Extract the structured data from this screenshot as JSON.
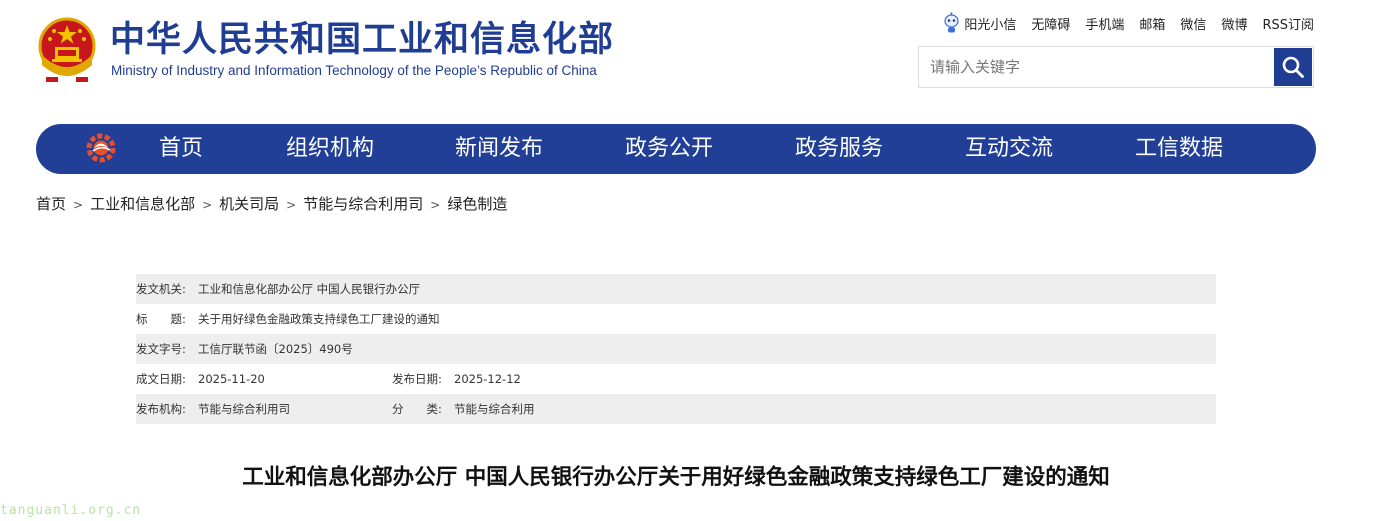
{
  "header": {
    "site_name_cn": "中华人民共和国工业和信息化部",
    "site_name_en": "Ministry of Industry and Information Technology of the People’s Republic of China",
    "emblem_icon": "national-emblem-icon",
    "brand_color": "#1f3d93"
  },
  "toplinks": {
    "robot_icon": "robot-assistant-icon",
    "items": [
      "阳光小信",
      "无障碍",
      "手机端",
      "邮箱",
      "微信",
      "微博",
      "RSS订阅"
    ]
  },
  "search": {
    "placeholder": "请输入关键字",
    "value": "",
    "button_icon": "search-icon"
  },
  "nav": {
    "logo_icon": "gear-logo-icon",
    "items": [
      "首页",
      "组织机构",
      "新闻发布",
      "政务公开",
      "政务服务",
      "互动交流",
      "工信数据"
    ]
  },
  "breadcrumb": {
    "separator": ">",
    "items": [
      "首页",
      "工业和信息化部",
      "机关司局",
      "节能与综合利用司",
      "绿色制造"
    ]
  },
  "meta": {
    "issuer_label": "发文机关:",
    "issuer": "工业和信息化部办公厅 中国人民银行办公厅",
    "subject_label": "标　　题:",
    "subject": "关于用好绿色金融政策支持绿色工厂建设的通知",
    "doc_no_label": "发文字号:",
    "doc_no": "工信厅联节函〔2025〕490号",
    "created_label": "成文日期:",
    "created": "2025-11-20",
    "published_label": "发布日期:",
    "published": "2025-12-12",
    "agency_label": "发布机构:",
    "agency": "节能与综合利用司",
    "category_label": "分　　类:",
    "category": "节能与综合利用"
  },
  "document": {
    "title": "工业和信息化部办公厅 中国人民银行办公厅关于用好绿色金融政策支持绿色工厂建设的通知"
  },
  "watermark": "tanguanli.org.cn"
}
